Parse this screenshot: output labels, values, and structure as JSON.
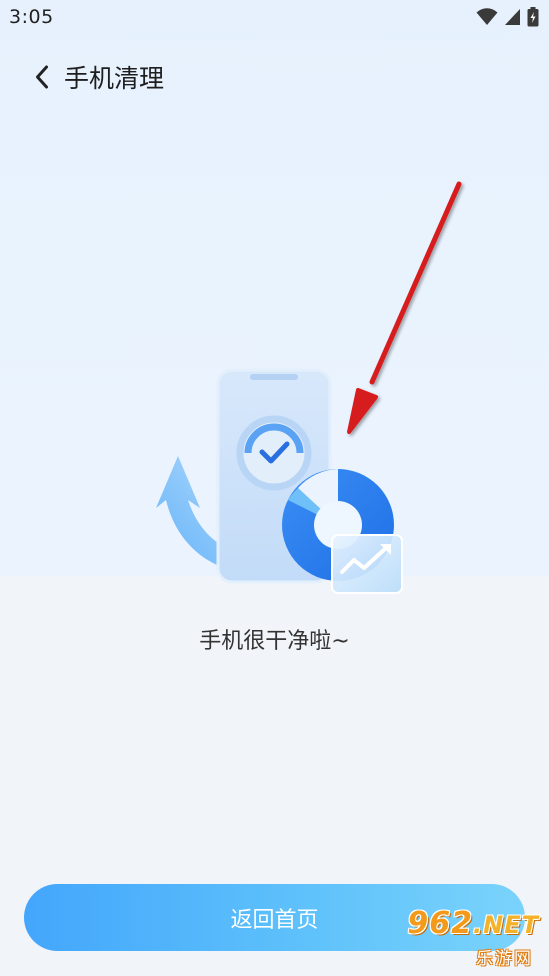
{
  "status_bar": {
    "time": "3:05",
    "icons": [
      "wifi-icon",
      "cellular-signal-icon",
      "battery-charging-icon"
    ]
  },
  "nav": {
    "back_icon": "chevron-left-icon",
    "title": "手机清理"
  },
  "illustration": {
    "icons": [
      "phone-icon",
      "check-icon",
      "refresh-arrow-icon",
      "donut-chart-icon",
      "trend-up-icon"
    ]
  },
  "annotation": {
    "icon": "red-arrow-icon",
    "color": "#d61e1e"
  },
  "result": {
    "message": "手机很干净啦~"
  },
  "footer": {
    "home_button_label": "返回首页"
  },
  "watermark": {
    "logo_main": "962",
    "logo_suffix": ".NET",
    "logo_sub": "乐游网"
  },
  "colors": {
    "accent": "#4aa8fb",
    "button_gradient_start": "#43a6fb",
    "button_gradient_end": "#7ad3fb",
    "background_top": "#e8f2fe",
    "background_bottom": "#f1f4f9"
  }
}
